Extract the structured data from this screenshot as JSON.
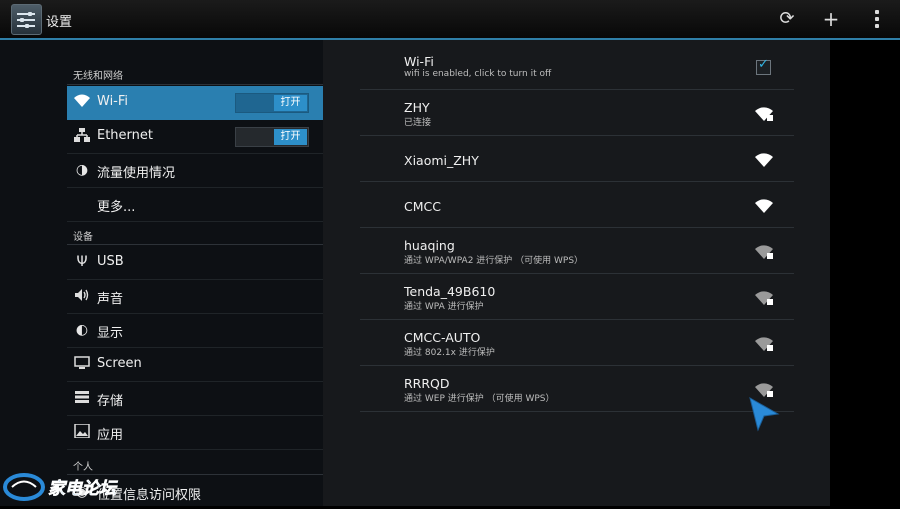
{
  "app": {
    "title": "设置",
    "icon": "settings-sliders-icon",
    "actions": [
      {
        "icon": "refresh-icon"
      },
      {
        "icon": "add-icon"
      },
      {
        "icon": "overflow-menu-icon"
      }
    ]
  },
  "sidebar": {
    "sections": {
      "wireless": "无线和网络",
      "device": "设备",
      "personal": "个人"
    },
    "items": [
      {
        "label": "Wi-Fi",
        "icon": "wifi-icon",
        "selected": true,
        "toggle": "打开"
      },
      {
        "label": "Ethernet",
        "icon": "ethernet-icon",
        "toggle": "打开"
      },
      {
        "label": "流量使用情况",
        "icon": "data-usage-icon"
      },
      {
        "label": "更多..."
      },
      {
        "label": "USB",
        "icon": "usb-icon"
      },
      {
        "label": "声音",
        "icon": "volume-icon"
      },
      {
        "label": "显示",
        "icon": "brightness-icon"
      },
      {
        "label": "Screen",
        "icon": "screen-icon"
      },
      {
        "label": "存储",
        "icon": "storage-icon"
      },
      {
        "label": "应用",
        "icon": "apps-icon"
      },
      {
        "label": "位置信息访问权限",
        "icon": "location-icon"
      }
    ]
  },
  "wifi": {
    "header": {
      "title": "Wi-Fi",
      "subtitle": "wifi is enabled, click to turn it off",
      "checked": true
    },
    "networks": [
      {
        "name": "ZHY",
        "status": "已连接",
        "secured": true
      },
      {
        "name": "Xiaomi_ZHY",
        "status": "",
        "secured": false
      },
      {
        "name": "CMCC",
        "status": "",
        "secured": false
      },
      {
        "name": "huaqing",
        "status": "通过 WPA/WPA2 进行保护 （可使用 WPS）",
        "secured": true
      },
      {
        "name": "Tenda_49B610",
        "status": "通过 WPA 进行保护",
        "secured": true
      },
      {
        "name": "CMCC-AUTO",
        "status": "通过 802.1x 进行保护",
        "secured": true
      },
      {
        "name": "RRRQD",
        "status": "通过 WEP 进行保护 （可使用 WPS）",
        "secured": true
      }
    ]
  },
  "colors": {
    "accent": "#2a7fb0",
    "action_bar_line": "#2f7fa8",
    "checkbox": "#33b5e5"
  },
  "watermark": "家电论坛"
}
